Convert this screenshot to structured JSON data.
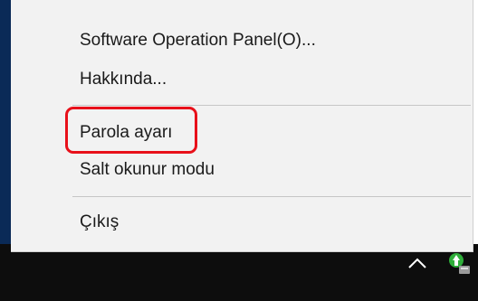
{
  "context_menu": {
    "items": [
      {
        "label": "Software Operation Panel(O)..."
      },
      {
        "label": "Hakkında..."
      },
      {
        "label": "Parola ayarı"
      },
      {
        "label": "Salt okunur modu"
      },
      {
        "label": "Çıkış"
      }
    ],
    "highlighted_item": "Parola ayarı",
    "highlight_color": "#e8101a"
  },
  "taskbar": {
    "tray_icons": [
      "chevron-up-icon",
      "scanner-app-icon"
    ]
  }
}
